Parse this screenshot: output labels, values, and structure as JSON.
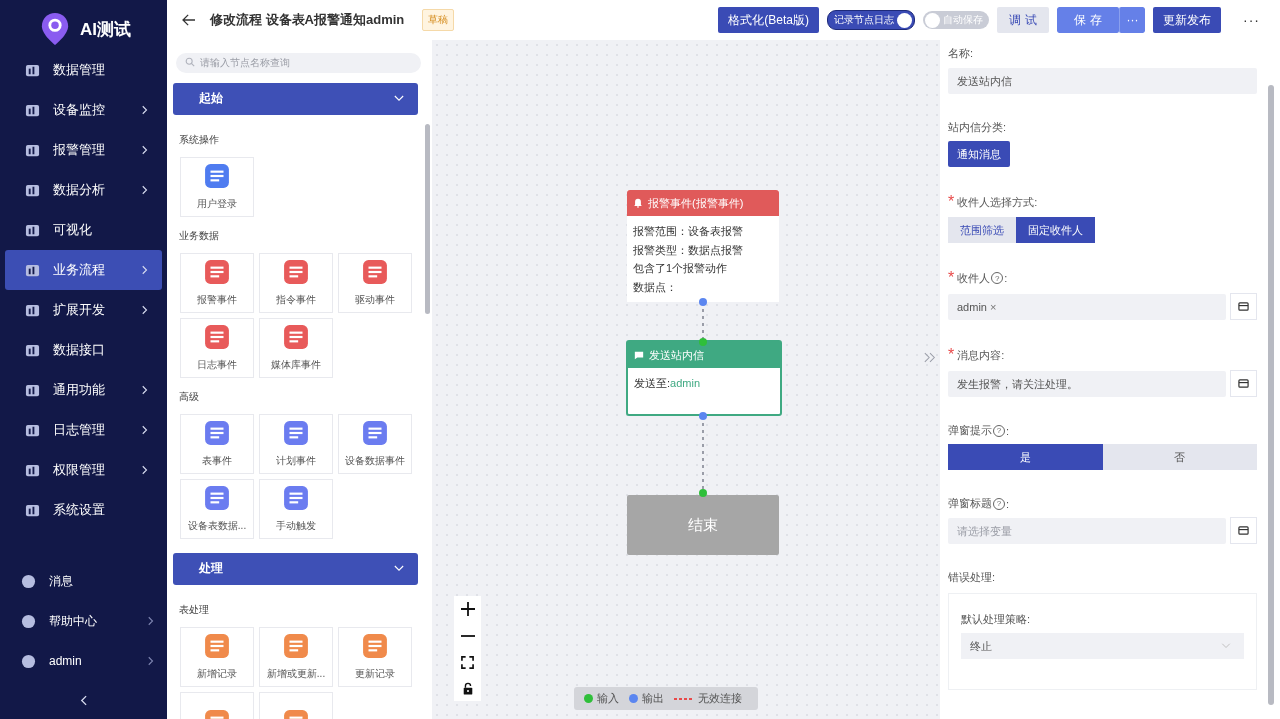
{
  "app": {
    "title": "AI测试"
  },
  "sidebar": {
    "items": [
      {
        "label": "数据管理",
        "submenu": false,
        "selected": false
      },
      {
        "label": "设备监控",
        "submenu": true,
        "selected": false
      },
      {
        "label": "报警管理",
        "submenu": true,
        "selected": false
      },
      {
        "label": "数据分析",
        "submenu": true,
        "selected": false
      },
      {
        "label": "可视化",
        "submenu": false,
        "selected": false
      },
      {
        "label": "业务流程",
        "submenu": true,
        "selected": true
      },
      {
        "label": "扩展开发",
        "submenu": true,
        "selected": false
      },
      {
        "label": "数据接口",
        "submenu": false,
        "selected": false
      },
      {
        "label": "通用功能",
        "submenu": true,
        "selected": false
      },
      {
        "label": "日志管理",
        "submenu": true,
        "selected": false
      },
      {
        "label": "权限管理",
        "submenu": true,
        "selected": false
      },
      {
        "label": "系统设置",
        "submenu": false,
        "selected": false
      }
    ],
    "bottom_items": [
      {
        "label": "消息",
        "submenu": false
      },
      {
        "label": "帮助中心",
        "submenu": true
      },
      {
        "label": "admin",
        "submenu": true
      }
    ]
  },
  "toolbar": {
    "title": "修改流程 设备表A报警通知admin",
    "badge": "草稿",
    "format_button": "格式化(Beta版)",
    "toggles": [
      {
        "label": "记录节点日志",
        "on": true
      },
      {
        "label": "自动保存",
        "on": false
      }
    ],
    "debug_button": "调 试",
    "save_button": "保 存",
    "save_more": "···",
    "publish_button": "更新发布",
    "more": "···"
  },
  "palette": {
    "search_placeholder": "请输入节点名称查询",
    "sections": [
      {
        "title": "起始",
        "expanded": true,
        "groups": [
          {
            "title": "系统操作",
            "items": [
              {
                "label": "用户登录",
                "color": "#4f7cf0"
              }
            ]
          },
          {
            "title": "业务数据",
            "items": [
              {
                "label": "报警事件",
                "color": "#e85a5a"
              },
              {
                "label": "指令事件",
                "color": "#e85a5a"
              },
              {
                "label": "驱动事件",
                "color": "#e85a5a"
              },
              {
                "label": "日志事件",
                "color": "#e85a5a"
              },
              {
                "label": "媒体库事件",
                "color": "#e85a5a"
              }
            ]
          },
          {
            "title": "高级",
            "items": [
              {
                "label": "表事件",
                "color": "#6b7cf0"
              },
              {
                "label": "计划事件",
                "color": "#6b7cf0"
              },
              {
                "label": "设备数据事件",
                "color": "#6b7cf0"
              },
              {
                "label": "设备表数据...",
                "color": "#6b7cf0"
              },
              {
                "label": "手动触发",
                "color": "#6b7cf0"
              }
            ]
          }
        ]
      },
      {
        "title": "处理",
        "expanded": true,
        "groups": [
          {
            "title": "表处理",
            "items": [
              {
                "label": "新增记录",
                "color": "#f08a4b"
              },
              {
                "label": "新增或更新...",
                "color": "#f08a4b"
              },
              {
                "label": "更新记录",
                "color": "#f08a4b"
              },
              {
                "color": "#f08a4b"
              },
              {
                "color": "#f08a4b"
              }
            ]
          }
        ]
      }
    ]
  },
  "canvas": {
    "nodes": [
      {
        "kind": "event",
        "title": "报警事件(报警事件)",
        "lines": [
          "报警范围：设备表报警",
          "报警类型：数据点报警",
          "包含了1个报警动作",
          "数据点："
        ]
      },
      {
        "kind": "action",
        "title": "发送站内信",
        "body_label": "发送至:",
        "body_value": "admin"
      },
      {
        "kind": "end",
        "title": "结束"
      }
    ],
    "legend": [
      {
        "label": "输入",
        "kind": "dot",
        "color": "#2fbf3a"
      },
      {
        "label": "输出",
        "kind": "dot",
        "color": "#5b86f0"
      },
      {
        "label": "无效连接",
        "kind": "dash",
        "color": "#e84a4a"
      }
    ]
  },
  "form": {
    "name": {
      "label": "名称:",
      "value": "发送站内信"
    },
    "category": {
      "label": "站内信分类:",
      "value": "通知消息"
    },
    "recipient_mode": {
      "label": "收件人选择方式:",
      "required_mark": "*",
      "options": [
        {
          "label": "范围筛选",
          "selected": false
        },
        {
          "label": "固定收件人",
          "selected": true
        }
      ]
    },
    "recipient": {
      "label": "收件人",
      "help": "?",
      "colon": ":",
      "required_mark": "*",
      "tags": [
        {
          "label": "admin",
          "remove": "×"
        }
      ]
    },
    "message": {
      "label": "消息内容:",
      "required_mark": "*",
      "value": "发生报警，请关注处理。"
    },
    "popup": {
      "label": "弹窗提示",
      "help": "?",
      "colon": ":",
      "options": [
        {
          "label": "是",
          "selected": true
        },
        {
          "label": "否",
          "selected": false
        }
      ]
    },
    "popup_title": {
      "label": "弹窗标题",
      "help": "?",
      "colon": ":",
      "placeholder": "请选择变量"
    },
    "error": {
      "label": "错误处理:",
      "strategy_label": "默认处理策略:",
      "strategy": "终止"
    }
  }
}
